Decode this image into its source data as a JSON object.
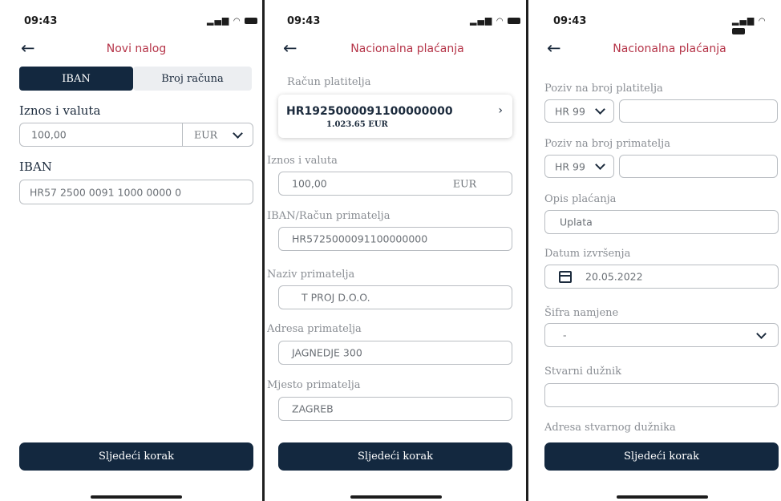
{
  "status_time": "09:43",
  "screen1": {
    "title": "Novi nalog",
    "tabs": [
      "IBAN",
      "Broj računa"
    ],
    "amount_label": "Iznos i valuta",
    "amount_value": "100,00",
    "currency": "EUR",
    "iban_label": "IBAN",
    "iban_value": "HR57 2500 0091 1000 0000 0",
    "next_button": "Sljedeći korak"
  },
  "screen2": {
    "title": "Nacionalna plaćanja",
    "payer_account_label": "Račun platitelja",
    "payer_account": "HR1925000091100000000",
    "payer_balance": "1.023.65 EUR",
    "amount_label": "Iznos i valuta",
    "amount_value": "100,00",
    "currency": "EUR",
    "iban_label": "IBAN/Račun primatelja",
    "iban_value": "HR5725000091100000000",
    "recipient_name_label": "Naziv primatelja",
    "recipient_name": "T PROJ D.O.O.",
    "recipient_address_label": "Adresa primatelja",
    "recipient_address": "JAGNEDJE 300",
    "recipient_city_label": "Mjesto primatelja",
    "recipient_city": "ZAGREB",
    "next_button": "Sljedeći korak"
  },
  "screen3": {
    "title": "Nacionalna plaćanja",
    "payer_ref_label": "Poziv na broj platitelja",
    "payer_ref_model": "HR 99",
    "payee_ref_label": "Poziv na broj primatelja",
    "payee_ref_model": "HR 99",
    "description_label": "Opis plaćanja",
    "description_value": "Uplata",
    "date_label": "Datum izvršenja",
    "date_value": "20.05.2022",
    "purpose_label": "Šifra namjene",
    "purpose_value": "-",
    "debtor_label": "Stvarni dužnik",
    "debtor_address_label": "Adresa stvarnog dužnika",
    "next_button": "Sljedeći korak"
  },
  "icons": {
    "back": "arrow-left-icon",
    "signal": "signal-icon",
    "wifi": "wifi-icon",
    "battery": "battery-icon",
    "chevron_down": "chevron-down-icon",
    "chevron_right": "chevron-right-icon",
    "calendar": "calendar-icon"
  },
  "colors": {
    "primary": "#13283f",
    "title_red": "#b53448",
    "border": "#b9bdc2"
  }
}
